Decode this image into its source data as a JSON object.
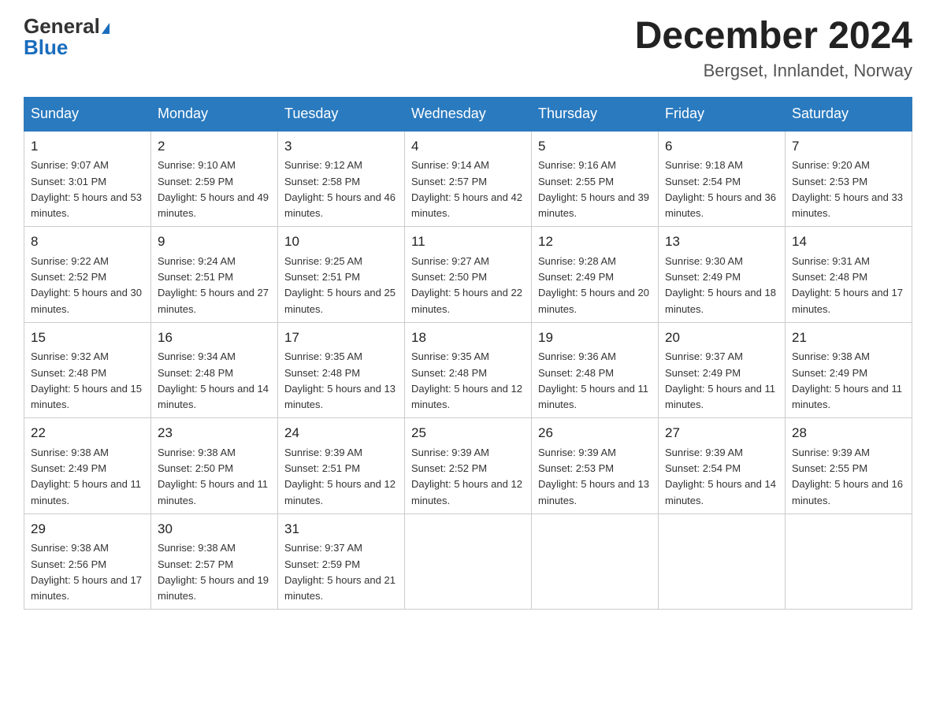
{
  "logo": {
    "general": "General",
    "blue": "Blue"
  },
  "title": "December 2024",
  "subtitle": "Bergset, Innlandet, Norway",
  "weekdays": [
    "Sunday",
    "Monday",
    "Tuesday",
    "Wednesday",
    "Thursday",
    "Friday",
    "Saturday"
  ],
  "weeks": [
    [
      {
        "day": "1",
        "sunrise": "Sunrise: 9:07 AM",
        "sunset": "Sunset: 3:01 PM",
        "daylight": "Daylight: 5 hours and 53 minutes."
      },
      {
        "day": "2",
        "sunrise": "Sunrise: 9:10 AM",
        "sunset": "Sunset: 2:59 PM",
        "daylight": "Daylight: 5 hours and 49 minutes."
      },
      {
        "day": "3",
        "sunrise": "Sunrise: 9:12 AM",
        "sunset": "Sunset: 2:58 PM",
        "daylight": "Daylight: 5 hours and 46 minutes."
      },
      {
        "day": "4",
        "sunrise": "Sunrise: 9:14 AM",
        "sunset": "Sunset: 2:57 PM",
        "daylight": "Daylight: 5 hours and 42 minutes."
      },
      {
        "day": "5",
        "sunrise": "Sunrise: 9:16 AM",
        "sunset": "Sunset: 2:55 PM",
        "daylight": "Daylight: 5 hours and 39 minutes."
      },
      {
        "day": "6",
        "sunrise": "Sunrise: 9:18 AM",
        "sunset": "Sunset: 2:54 PM",
        "daylight": "Daylight: 5 hours and 36 minutes."
      },
      {
        "day": "7",
        "sunrise": "Sunrise: 9:20 AM",
        "sunset": "Sunset: 2:53 PM",
        "daylight": "Daylight: 5 hours and 33 minutes."
      }
    ],
    [
      {
        "day": "8",
        "sunrise": "Sunrise: 9:22 AM",
        "sunset": "Sunset: 2:52 PM",
        "daylight": "Daylight: 5 hours and 30 minutes."
      },
      {
        "day": "9",
        "sunrise": "Sunrise: 9:24 AM",
        "sunset": "Sunset: 2:51 PM",
        "daylight": "Daylight: 5 hours and 27 minutes."
      },
      {
        "day": "10",
        "sunrise": "Sunrise: 9:25 AM",
        "sunset": "Sunset: 2:51 PM",
        "daylight": "Daylight: 5 hours and 25 minutes."
      },
      {
        "day": "11",
        "sunrise": "Sunrise: 9:27 AM",
        "sunset": "Sunset: 2:50 PM",
        "daylight": "Daylight: 5 hours and 22 minutes."
      },
      {
        "day": "12",
        "sunrise": "Sunrise: 9:28 AM",
        "sunset": "Sunset: 2:49 PM",
        "daylight": "Daylight: 5 hours and 20 minutes."
      },
      {
        "day": "13",
        "sunrise": "Sunrise: 9:30 AM",
        "sunset": "Sunset: 2:49 PM",
        "daylight": "Daylight: 5 hours and 18 minutes."
      },
      {
        "day": "14",
        "sunrise": "Sunrise: 9:31 AM",
        "sunset": "Sunset: 2:48 PM",
        "daylight": "Daylight: 5 hours and 17 minutes."
      }
    ],
    [
      {
        "day": "15",
        "sunrise": "Sunrise: 9:32 AM",
        "sunset": "Sunset: 2:48 PM",
        "daylight": "Daylight: 5 hours and 15 minutes."
      },
      {
        "day": "16",
        "sunrise": "Sunrise: 9:34 AM",
        "sunset": "Sunset: 2:48 PM",
        "daylight": "Daylight: 5 hours and 14 minutes."
      },
      {
        "day": "17",
        "sunrise": "Sunrise: 9:35 AM",
        "sunset": "Sunset: 2:48 PM",
        "daylight": "Daylight: 5 hours and 13 minutes."
      },
      {
        "day": "18",
        "sunrise": "Sunrise: 9:35 AM",
        "sunset": "Sunset: 2:48 PM",
        "daylight": "Daylight: 5 hours and 12 minutes."
      },
      {
        "day": "19",
        "sunrise": "Sunrise: 9:36 AM",
        "sunset": "Sunset: 2:48 PM",
        "daylight": "Daylight: 5 hours and 11 minutes."
      },
      {
        "day": "20",
        "sunrise": "Sunrise: 9:37 AM",
        "sunset": "Sunset: 2:49 PM",
        "daylight": "Daylight: 5 hours and 11 minutes."
      },
      {
        "day": "21",
        "sunrise": "Sunrise: 9:38 AM",
        "sunset": "Sunset: 2:49 PM",
        "daylight": "Daylight: 5 hours and 11 minutes."
      }
    ],
    [
      {
        "day": "22",
        "sunrise": "Sunrise: 9:38 AM",
        "sunset": "Sunset: 2:49 PM",
        "daylight": "Daylight: 5 hours and 11 minutes."
      },
      {
        "day": "23",
        "sunrise": "Sunrise: 9:38 AM",
        "sunset": "Sunset: 2:50 PM",
        "daylight": "Daylight: 5 hours and 11 minutes."
      },
      {
        "day": "24",
        "sunrise": "Sunrise: 9:39 AM",
        "sunset": "Sunset: 2:51 PM",
        "daylight": "Daylight: 5 hours and 12 minutes."
      },
      {
        "day": "25",
        "sunrise": "Sunrise: 9:39 AM",
        "sunset": "Sunset: 2:52 PM",
        "daylight": "Daylight: 5 hours and 12 minutes."
      },
      {
        "day": "26",
        "sunrise": "Sunrise: 9:39 AM",
        "sunset": "Sunset: 2:53 PM",
        "daylight": "Daylight: 5 hours and 13 minutes."
      },
      {
        "day": "27",
        "sunrise": "Sunrise: 9:39 AM",
        "sunset": "Sunset: 2:54 PM",
        "daylight": "Daylight: 5 hours and 14 minutes."
      },
      {
        "day": "28",
        "sunrise": "Sunrise: 9:39 AM",
        "sunset": "Sunset: 2:55 PM",
        "daylight": "Daylight: 5 hours and 16 minutes."
      }
    ],
    [
      {
        "day": "29",
        "sunrise": "Sunrise: 9:38 AM",
        "sunset": "Sunset: 2:56 PM",
        "daylight": "Daylight: 5 hours and 17 minutes."
      },
      {
        "day": "30",
        "sunrise": "Sunrise: 9:38 AM",
        "sunset": "Sunset: 2:57 PM",
        "daylight": "Daylight: 5 hours and 19 minutes."
      },
      {
        "day": "31",
        "sunrise": "Sunrise: 9:37 AM",
        "sunset": "Sunset: 2:59 PM",
        "daylight": "Daylight: 5 hours and 21 minutes."
      },
      null,
      null,
      null,
      null
    ]
  ]
}
